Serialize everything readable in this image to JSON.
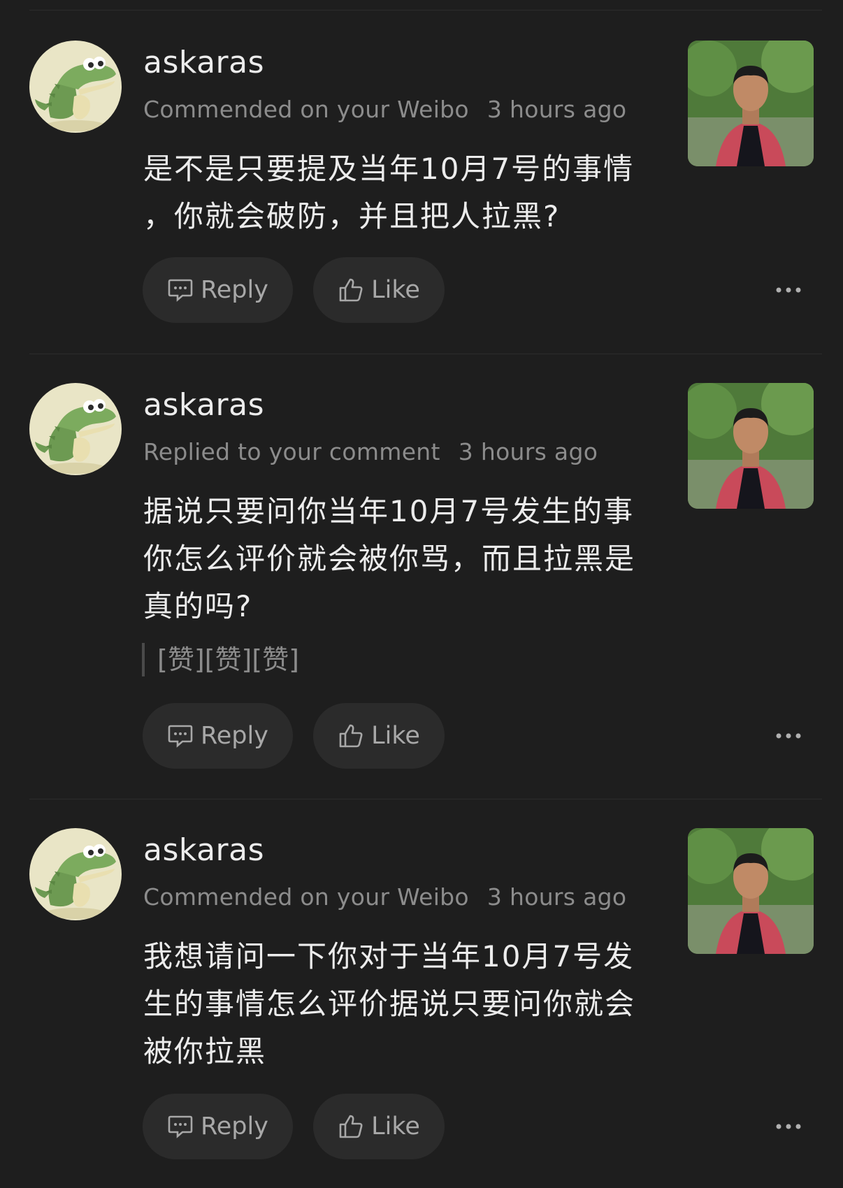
{
  "colors": {
    "background": "#1e1e1e",
    "primary_text": "#ececec",
    "secondary_text": "#8c8c8c",
    "pill_background": "#2b2b2b",
    "divider": "#2c2c2c"
  },
  "actions": {
    "reply_label": "Reply",
    "like_label": "Like",
    "reply_icon": "comment-icon",
    "like_icon": "thumbs-up-icon",
    "more_icon": "more-horizontal-icon"
  },
  "notifications": [
    {
      "username": "askaras",
      "action": "Commended on your Weibo",
      "time": "3 hours ago",
      "lines": [
        "是不是只要提及当年10月7号的事情",
        "，你就会破防，并且把人拉黑?"
      ],
      "quote": ""
    },
    {
      "username": "askaras",
      "action": "Replied to your comment",
      "time": "3 hours ago",
      "lines": [
        "据说只要问你当年10月7号发生的事",
        "你怎么评价就会被你骂，而且拉黑是",
        "真的吗?"
      ],
      "quote": "[赞][赞][赞]"
    },
    {
      "username": "askaras",
      "action": "Commended on your Weibo",
      "time": "3 hours ago",
      "lines": [
        "我想请问一下你对于当年10月7号发",
        "生的事情怎么评价据说只要问你就会",
        "被你拉黑"
      ],
      "quote": ""
    }
  ]
}
